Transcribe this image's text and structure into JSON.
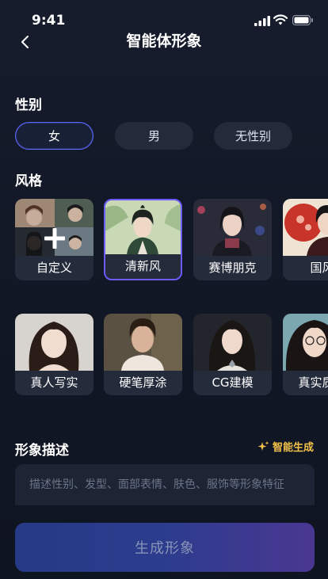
{
  "status_bar": {
    "time": "9:41"
  },
  "nav": {
    "title": "智能体形象"
  },
  "gender": {
    "label": "性别",
    "options": [
      "女",
      "男",
      "无性别"
    ],
    "selected": "女"
  },
  "style": {
    "label": "风格",
    "cards": [
      {
        "label": "自定义",
        "icon": "plus-icon"
      },
      {
        "label": "清新风",
        "selected": true
      },
      {
        "label": "赛博朋克"
      },
      {
        "label": "国风"
      },
      {
        "label": "真人写实"
      },
      {
        "label": "硬笔厚涂"
      },
      {
        "label": "CG建模"
      },
      {
        "label": "真实质感"
      }
    ]
  },
  "description": {
    "label": "形象描述",
    "smart_generate": "智能生成",
    "placeholder": "描述性别、发型、面部表情、肤色、服饰等形象特征"
  },
  "generate_button": "生成形象",
  "colors": {
    "accent": "#5a6cff",
    "selected_border": "#6b5cff",
    "smart_generate": "#f2c14a",
    "button_start": "#253a86",
    "button_end": "#4a3792"
  }
}
